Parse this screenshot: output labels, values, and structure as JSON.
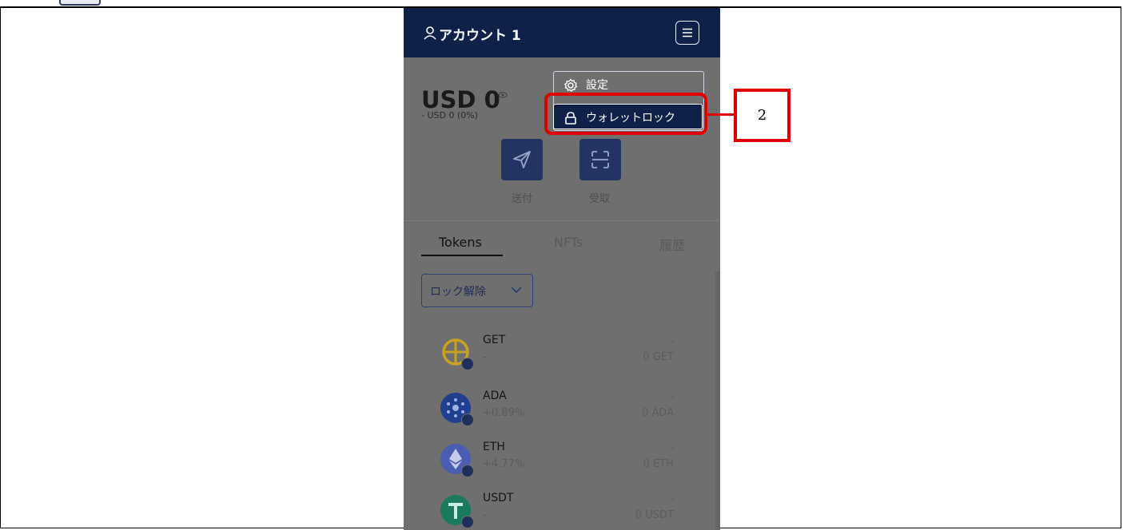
{
  "header": {
    "account_name": "アカウント 1"
  },
  "wallet": {
    "balance": "USD 0",
    "change": "- USD 0 (0%)",
    "send_label": "送付",
    "receive_label": "受取"
  },
  "tabs": [
    {
      "label": "Tokens",
      "active": true
    },
    {
      "label": "NFTs",
      "active": false
    },
    {
      "label": "履歴",
      "active": false
    }
  ],
  "filter": {
    "selected": "ロック解除"
  },
  "tokens": [
    {
      "symbol": "GET",
      "change": "-",
      "fiat": "-",
      "amount": "0 GET",
      "color": "#c9a221"
    },
    {
      "symbol": "ADA",
      "change": "+0.89%",
      "fiat": "-",
      "amount": "0 ADA",
      "color": "#1f3f8f"
    },
    {
      "symbol": "ETH",
      "change": "+4.77%",
      "fiat": "-",
      "amount": "0 ETH",
      "color": "#4a5db0"
    },
    {
      "symbol": "USDT",
      "change": "-",
      "fiat": "-",
      "amount": "0 USDT",
      "color": "#1b7a5e"
    }
  ],
  "menu": {
    "settings_label": "設定",
    "lock_label": "ウォレットロック"
  },
  "annotation": {
    "callout_number": "2",
    "highlight_color": "#e00000"
  }
}
